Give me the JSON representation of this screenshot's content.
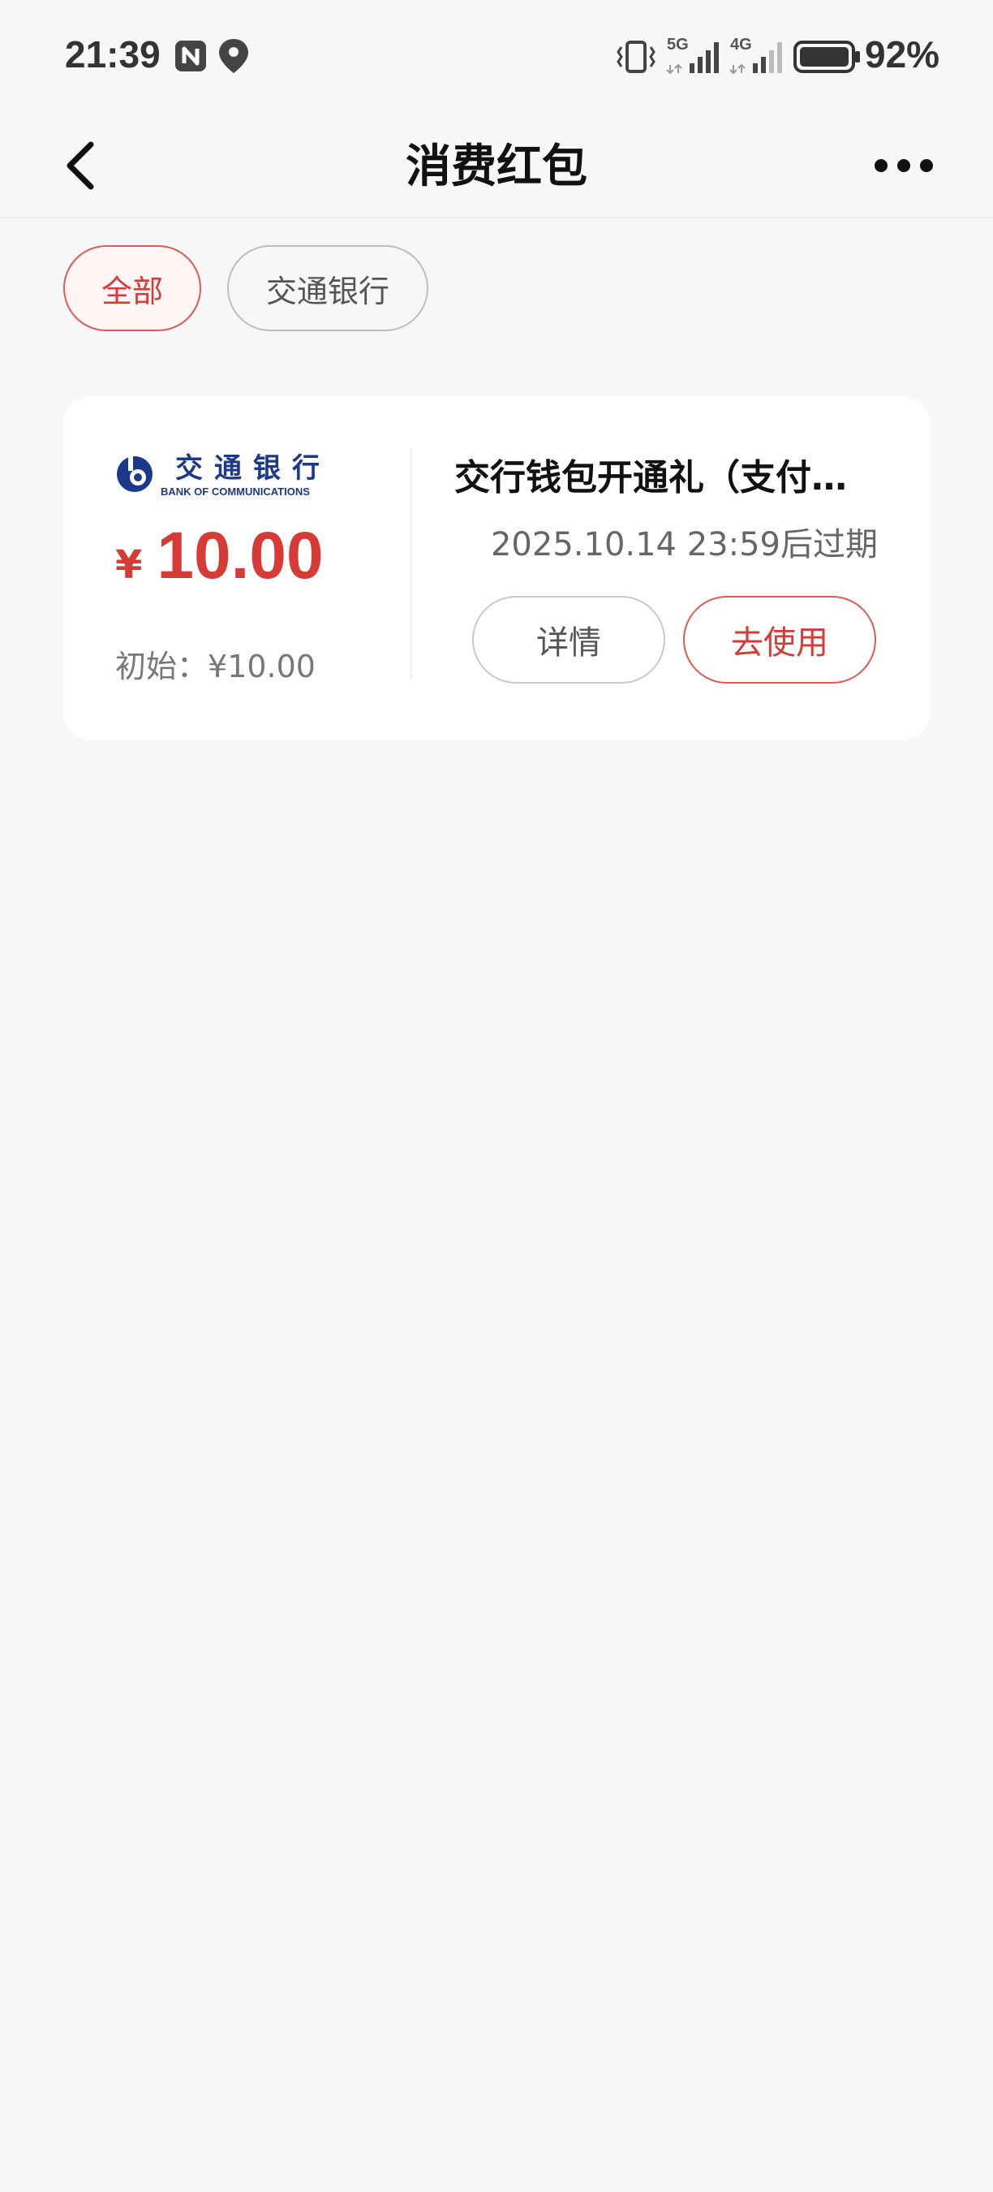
{
  "status_bar": {
    "time": "21:39",
    "net1": "5G",
    "net2": "4G",
    "battery": "92%",
    "icons": [
      "nfc-icon",
      "location-icon",
      "vibrate-icon",
      "signal-5g-icon",
      "signal-4g-icon",
      "battery-icon"
    ]
  },
  "nav": {
    "title": "消费红包",
    "back_icon": "chevron-left-icon",
    "more_icon": "more-horizontal-icon"
  },
  "filters": {
    "all": "全部",
    "bank": "交通银行",
    "selected": "全部"
  },
  "card": {
    "bank_logo_text_cn": "交通银行",
    "bank_logo_text_en": "BANK OF COMMUNICATIONS",
    "currency_symbol": "¥",
    "amount": "10.00",
    "initial": "初始：¥10.00",
    "title": "交行钱包开通礼（支付…",
    "expire": "2025.10.14 23:59后过期",
    "detail_button": "详情",
    "use_button": "去使用"
  },
  "colors": {
    "accent": "#d63b35",
    "background": "#f6f7f9",
    "bank_blue": "#1d3a8a"
  }
}
